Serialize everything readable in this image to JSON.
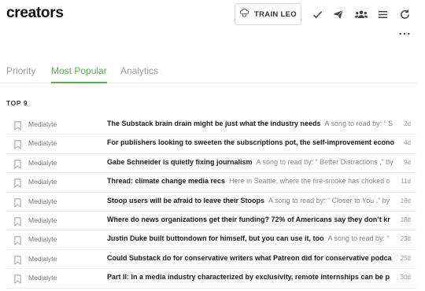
{
  "header": {
    "app_title": "creators",
    "train_button": "TRAIN LEO",
    "icons": [
      "brain-icon",
      "check-icon",
      "send-icon",
      "users-icon",
      "menu-icon",
      "refresh-icon",
      "more-icon"
    ]
  },
  "tabs": [
    {
      "label": "Priority",
      "active": false
    },
    {
      "label": "Most Popular",
      "active": true
    },
    {
      "label": "Analytics",
      "active": false
    }
  ],
  "section": {
    "label": "TOP 9"
  },
  "items": [
    {
      "source": "Medialyte",
      "title": "The Substack brain drain might be just what the industry needs",
      "snippet": "A song to read by: “ S",
      "age": "2d"
    },
    {
      "source": "Medialyte",
      "title": "For publishers looking to sweeten the subscriptions pot, the self-improvement econo",
      "snippet": "",
      "age": "4d"
    },
    {
      "source": "Medialyte",
      "title": "Gabe Schneider is quietly fixing journalism",
      "snippet": "A song to read by: “ Better Distractions ,” by",
      "age": "9d"
    },
    {
      "source": "Medialyte",
      "title": "Thread: climate change media recs",
      "snippet": "Here in Seattle, where the fire-smoke has choked o",
      "age": "11d"
    },
    {
      "source": "Medialyte",
      "title": "Stoop users will be afraid to leave their Stoops",
      "snippet": "A song to read by: “ Closer to You ,” by",
      "age": "16d"
    },
    {
      "source": "Medialyte",
      "title": "Where do news organizations get their funding? 72% of Americans say they don’t kr",
      "snippet": "",
      "age": "18d"
    },
    {
      "source": "Medialyte",
      "title": "Justin Duke built buttondown for himself, but you can use it, too",
      "snippet": "A song to read by: “",
      "age": "23d"
    },
    {
      "source": "Medialyte",
      "title": "Could Substack do for conservative writers what Patreon did for conservative podca",
      "snippet": "",
      "age": "25d"
    },
    {
      "source": "Medialyte",
      "title": "Part II: In a media industry characterized by exclusivity, remote internships can be p",
      "snippet": "",
      "age": "30d"
    }
  ]
}
